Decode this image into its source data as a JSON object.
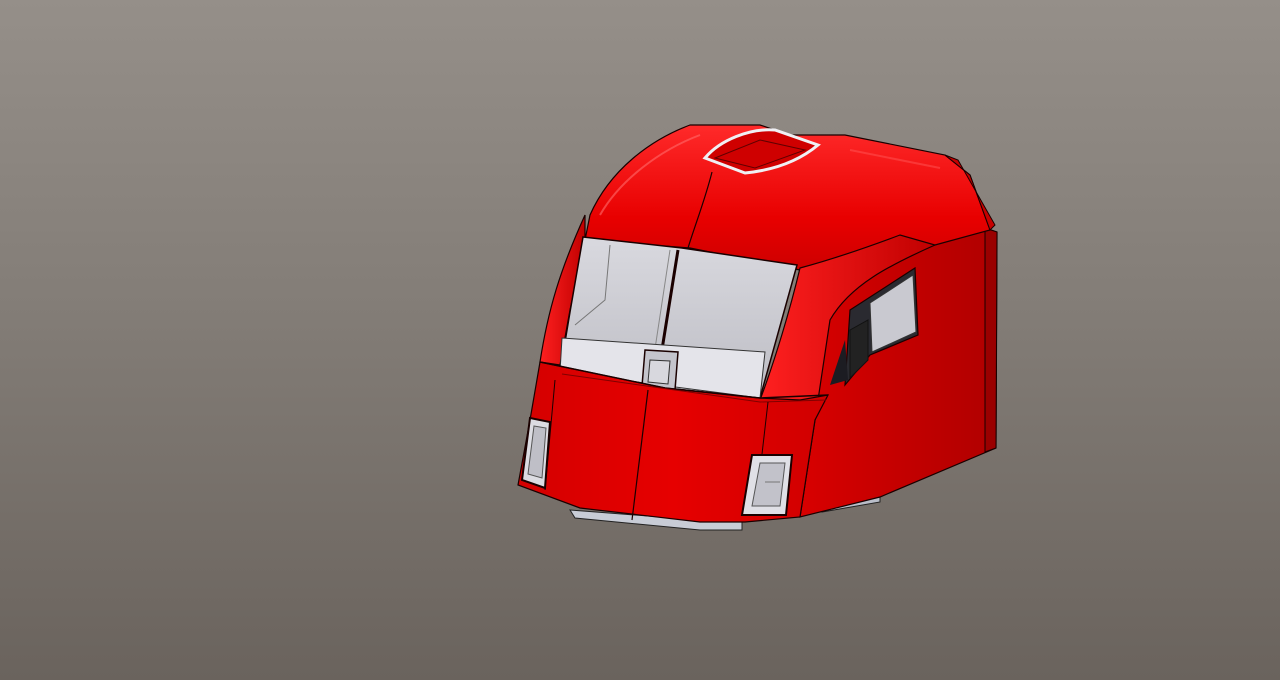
{
  "viewport": {
    "background_top": "#958f89",
    "background_bottom": "#6a635d"
  },
  "model": {
    "body_color": "#e00000",
    "body_highlight": "#ff1a1a",
    "body_shadow": "#a80000",
    "glass_color": "#c9c9cf",
    "glass_dark": "#2a2a30",
    "trim_color": "#d4d6dd",
    "edge_color": "#1a0000"
  }
}
